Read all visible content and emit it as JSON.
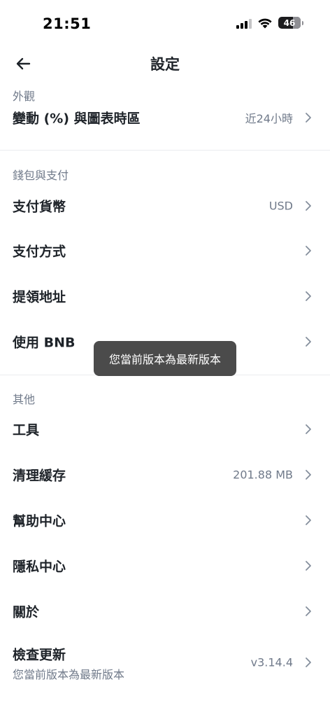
{
  "status_bar": {
    "time": "21:51",
    "battery": "46",
    "icons": [
      "signal-icon",
      "wifi-icon",
      "battery-icon"
    ]
  },
  "header": {
    "back_icon": "arrow-left-icon",
    "title": "設定"
  },
  "sections": {
    "appearance": {
      "title": "外觀",
      "items": [
        {
          "label": "變動 (%) 與圖表時區",
          "value": "近24小時"
        }
      ]
    },
    "wallet": {
      "title": "錢包與支付",
      "items": [
        {
          "label": "支付貨幣",
          "value": "USD"
        },
        {
          "label": "支付方式",
          "value": ""
        },
        {
          "label": "提領地址",
          "value": ""
        },
        {
          "label": "使用 BNB",
          "value": ""
        }
      ]
    },
    "other": {
      "title": "其他",
      "items": [
        {
          "label": "工具",
          "value": ""
        },
        {
          "label": "清理緩存",
          "value": "201.88 MB"
        },
        {
          "label": "幫助中心",
          "value": ""
        },
        {
          "label": "隱私中心",
          "value": ""
        },
        {
          "label": "關於",
          "value": ""
        },
        {
          "label": "檢查更新",
          "sublabel": "您當前版本為最新版本",
          "value": "v3.14.4"
        }
      ]
    }
  },
  "toast": {
    "message": "您當前版本為最新版本"
  },
  "colors": {
    "text_primary": "#1e2329",
    "text_secondary": "#707a8a",
    "divider": "#eaecef",
    "toast_bg": "#3c3c3c"
  }
}
